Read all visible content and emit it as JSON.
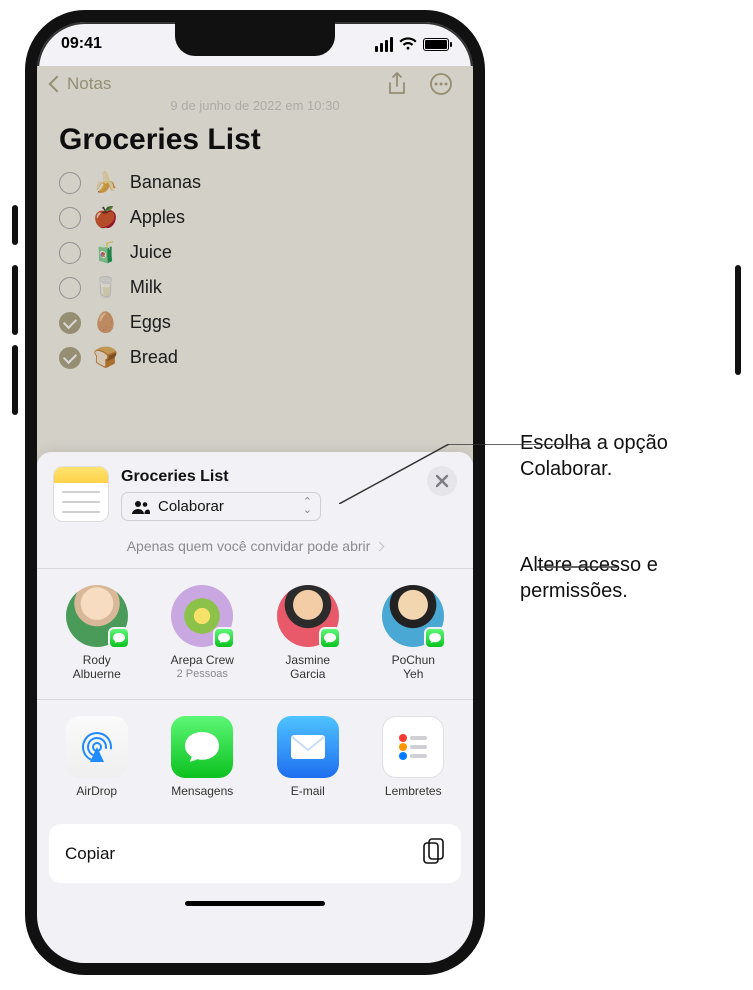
{
  "status_bar": {
    "time": "09:41"
  },
  "nav": {
    "back_label": "Notas",
    "date_stamp": "9 de junho de 2022 em 10:30"
  },
  "note": {
    "title": "Groceries List",
    "items": [
      {
        "emoji": "🍌",
        "label": "Bananas",
        "checked": false
      },
      {
        "emoji": "🍎",
        "label": "Apples",
        "checked": false
      },
      {
        "emoji": "🧃",
        "label": "Juice",
        "checked": false
      },
      {
        "emoji": "🥛",
        "label": "Milk",
        "checked": false
      },
      {
        "emoji": "🥚",
        "label": "Eggs",
        "checked": true
      },
      {
        "emoji": "🍞",
        "label": "Bread",
        "checked": true
      }
    ]
  },
  "sheet": {
    "title": "Groceries List",
    "collaborate_label": "Colaborar",
    "permission_text": "Apenas quem você convidar pode abrir",
    "contacts": [
      {
        "name_line1": "Rody",
        "name_line2": "Albuerne",
        "sub": ""
      },
      {
        "name_line1": "Arepa Crew",
        "name_line2": "",
        "sub": "2 Pessoas"
      },
      {
        "name_line1": "Jasmine",
        "name_line2": "Garcia",
        "sub": ""
      },
      {
        "name_line1": "PoChun",
        "name_line2": "Yeh",
        "sub": ""
      }
    ],
    "apps": [
      {
        "label": "AirDrop"
      },
      {
        "label": "Mensagens"
      },
      {
        "label": "E-mail"
      },
      {
        "label": "Lembretes"
      }
    ],
    "copy_label": "Copiar"
  },
  "callouts": {
    "collaborate": "Escolha a opção Colaborar.",
    "permissions": "Altere acesso e permissões."
  }
}
